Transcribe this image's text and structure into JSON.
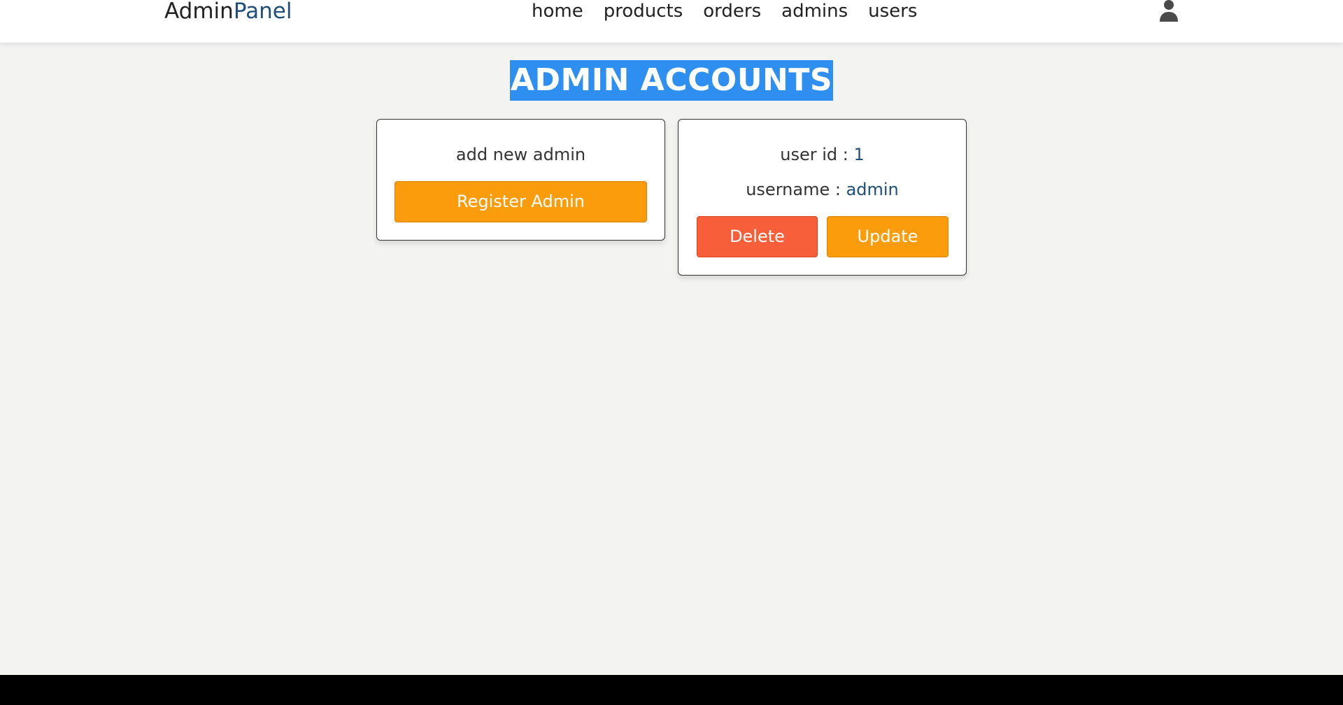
{
  "header": {
    "logo_main": "Admin",
    "logo_accent": "Panel",
    "nav": [
      {
        "label": "home"
      },
      {
        "label": "products"
      },
      {
        "label": "orders"
      },
      {
        "label": "admins"
      },
      {
        "label": "users"
      }
    ],
    "user_icon": "user-icon"
  },
  "page_title": "ADMIN ACCOUNTS",
  "add_card": {
    "text": "add new admin",
    "button_label": "Register Admin"
  },
  "admin_card": {
    "user_id_label": "user id : ",
    "user_id_value": "1",
    "username_label": "username : ",
    "username_value": "admin",
    "delete_label": "Delete",
    "update_label": "Update"
  },
  "colors": {
    "accent": "#1f4e79",
    "title_bg": "#2f8ff0",
    "orange_button": "#fa9c0b",
    "red_button": "#f65f3a",
    "page_bg": "#f3f3f2"
  }
}
